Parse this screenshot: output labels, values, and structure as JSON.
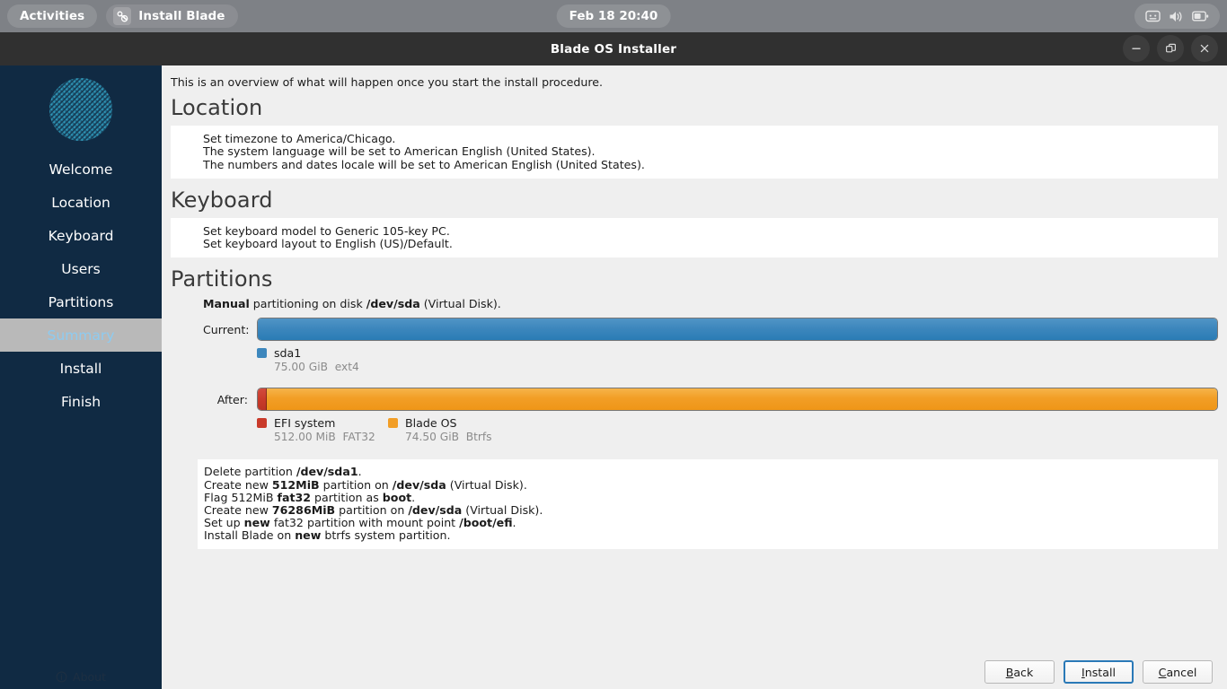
{
  "topbar": {
    "activities_label": "Activities",
    "app_label": "Install Blade",
    "app_icon": "installer-icon",
    "clock": "Feb 18  20:40",
    "indicators": [
      {
        "icon": "screencast-display-icon"
      },
      {
        "icon": "volume-speaker-icon"
      },
      {
        "icon": "battery-icon"
      }
    ]
  },
  "window": {
    "title": "Blade OS Installer",
    "controls": [
      {
        "name": "minimize-button",
        "glyph": "minimize-icon"
      },
      {
        "name": "maximize-button",
        "glyph": "maximize-icon"
      },
      {
        "name": "close-button",
        "glyph": "close-icon"
      }
    ]
  },
  "sidebar": {
    "logo_icon": "blade-striped-circle-logo",
    "items": [
      {
        "label": "Welcome",
        "active": false
      },
      {
        "label": "Location",
        "active": false
      },
      {
        "label": "Keyboard",
        "active": false
      },
      {
        "label": "Users",
        "active": false
      },
      {
        "label": "Partitions",
        "active": false
      },
      {
        "label": "Summary",
        "active": true
      },
      {
        "label": "Install",
        "active": false
      },
      {
        "label": "Finish",
        "active": false
      }
    ],
    "about_label": "About",
    "about_icon": "info-icon"
  },
  "main": {
    "intro": "This is an overview of what will happen once you start the install procedure.",
    "sections": [
      {
        "title": "Location",
        "lines": [
          "Set timezone to America/Chicago.",
          "The system language will be set to American English (United States).",
          "The numbers and dates locale will be set to American English (United States)."
        ]
      },
      {
        "title": "Keyboard",
        "lines": [
          "Set keyboard model to Generic 105-key PC.",
          "Set keyboard layout to English (US)/Default."
        ]
      }
    ],
    "partitions": {
      "title": "Partitions",
      "description_prefix": "",
      "description_bold_mode": "Manual",
      "description_mid": " partitioning on disk ",
      "description_bold_disk": "/dev/sda",
      "description_suffix": " (Virtual Disk).",
      "current_label": "Current:",
      "after_label": "After:",
      "current_segments": [
        {
          "name": "sda1",
          "size": "75.00 GiB",
          "fs": "ext4",
          "color": "#3d87bd",
          "percent": 100
        }
      ],
      "after_segments": [
        {
          "name": "EFI system",
          "size": "512.00 MiB",
          "fs": "FAT32",
          "color": "#c93a2a",
          "percent": 0.9
        },
        {
          "name": "Blade OS",
          "size": "74.50 GiB",
          "fs": "Btrfs",
          "color": "#f29e26",
          "percent": 99.1
        }
      ]
    },
    "actions": [
      [
        {
          "t": "Delete partition "
        },
        {
          "t": "/dev/sda1",
          "b": true
        },
        {
          "t": "."
        }
      ],
      [
        {
          "t": "Create new "
        },
        {
          "t": "512MiB",
          "b": true
        },
        {
          "t": " partition on "
        },
        {
          "t": "/dev/sda",
          "b": true
        },
        {
          "t": " (Virtual Disk)."
        }
      ],
      [
        {
          "t": "Flag 512MiB "
        },
        {
          "t": "fat32",
          "b": true
        },
        {
          "t": " partition as "
        },
        {
          "t": "boot",
          "b": true
        },
        {
          "t": "."
        }
      ],
      [
        {
          "t": "Create new "
        },
        {
          "t": "76286MiB",
          "b": true
        },
        {
          "t": " partition on "
        },
        {
          "t": "/dev/sda",
          "b": true
        },
        {
          "t": " (Virtual Disk)."
        }
      ],
      [
        {
          "t": "Set up "
        },
        {
          "t": "new",
          "b": true
        },
        {
          "t": " fat32 partition with mount point "
        },
        {
          "t": "/boot/efi",
          "b": true
        },
        {
          "t": "."
        }
      ],
      [
        {
          "t": "Install Blade on "
        },
        {
          "t": "new",
          "b": true
        },
        {
          "t": " btrfs system partition."
        }
      ]
    ]
  },
  "footer": {
    "buttons": [
      {
        "name": "back-button",
        "mnemonic": "B",
        "rest": "ack",
        "primary": false
      },
      {
        "name": "install-button",
        "mnemonic": "I",
        "rest": "nstall",
        "primary": true
      },
      {
        "name": "cancel-button",
        "mnemonic": "C",
        "rest": "ancel",
        "primary": false
      }
    ]
  },
  "colors": {
    "sidebar_bg": "#102a43",
    "active_item_bg": "#b9b9b9",
    "active_item_text": "#8ecbf0",
    "titlebar_bg": "#303030",
    "topbar_bg": "#7e8186",
    "content_bg": "#efefef",
    "panel_bg": "#ffffff",
    "accent_blue": "#3d87bd",
    "accent_orange": "#f29e26",
    "accent_red": "#c93a2a"
  }
}
